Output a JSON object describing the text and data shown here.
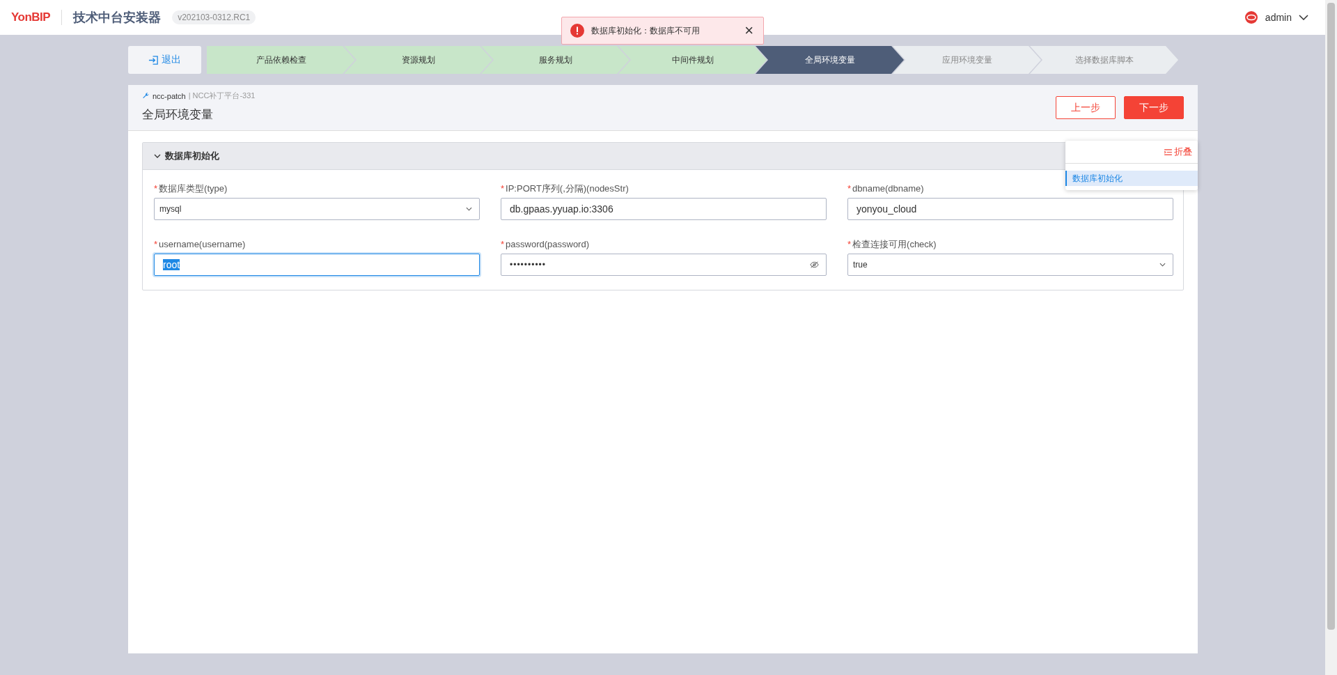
{
  "header": {
    "logo": "YonBIP",
    "app_title": "技术中台安装器",
    "version": "v202103-0312.RC1",
    "user": "admin"
  },
  "toast": {
    "message": "数据库初始化：数据库不可用",
    "close": "×"
  },
  "exit_button": "退出",
  "steps": [
    {
      "label": "产品依赖检查",
      "selected": false
    },
    {
      "label": "资源规划",
      "selected": false
    },
    {
      "label": "服务规划",
      "selected": false
    },
    {
      "label": "中间件规划",
      "selected": false
    },
    {
      "label": "全局环境变量",
      "selected": true
    },
    {
      "label": "应用环境变量",
      "selected": false
    },
    {
      "label": "选择数据库脚本",
      "selected": false
    }
  ],
  "page": {
    "breadcrumb_product": "ncc-patch",
    "breadcrumb_rest": "| NCC补丁平台-331",
    "title": "全局环境变量",
    "prev_button": "上一步",
    "next_button": "下一步"
  },
  "section": {
    "title": "数据库初始化",
    "expanded": true,
    "fields": [
      {
        "label": "数据库类型(type)",
        "required_mark": "*",
        "kind": "select",
        "value": "mysql"
      },
      {
        "label": "IP:PORT序列(,分隔)(nodesStr)",
        "required_mark": "*",
        "kind": "text",
        "value": "db.gpaas.yyuap.io:3306",
        "focused": false
      },
      {
        "label": "dbname(dbname)",
        "required_mark": "*",
        "kind": "text",
        "value": "yonyou_cloud",
        "focused": false
      },
      {
        "label": "username(username)",
        "required_mark": "*",
        "kind": "text",
        "value": "root",
        "focused": true
      },
      {
        "label": "password(password)",
        "required_mark": "*",
        "kind": "password",
        "value": "••••••••••",
        "focused": false
      },
      {
        "label": "检查连接可用(check)",
        "required_mark": "*",
        "kind": "select",
        "value": "true"
      }
    ]
  },
  "anchor_panel": {
    "collapse": "折叠",
    "items": [
      {
        "label": "数据库初始化",
        "selected": true
      }
    ]
  }
}
